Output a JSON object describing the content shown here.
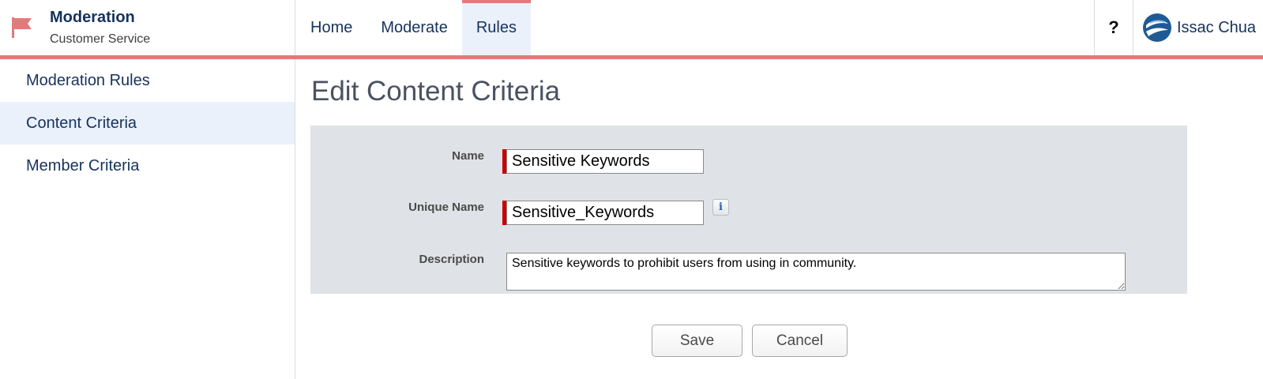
{
  "app": {
    "title": "Moderation",
    "subtitle": "Customer Service"
  },
  "nav": {
    "items": [
      {
        "label": "Home",
        "active": false
      },
      {
        "label": "Moderate",
        "active": false
      },
      {
        "label": "Rules",
        "active": true
      }
    ],
    "help_label": "?"
  },
  "user": {
    "name": "Issac Chua"
  },
  "sidebar": {
    "items": [
      {
        "label": "Moderation Rules",
        "active": false
      },
      {
        "label": "Content Criteria",
        "active": true
      },
      {
        "label": "Member Criteria",
        "active": false
      }
    ]
  },
  "page": {
    "title": "Edit Content Criteria"
  },
  "form": {
    "name_label": "Name",
    "name_value": "Sensitive Keywords",
    "unique_name_label": "Unique Name",
    "unique_name_value": "Sensitive_Keywords",
    "info_glyph": "i",
    "description_label": "Description",
    "description_value": "Sensitive keywords to prohibit users from using in community."
  },
  "buttons": {
    "save_label": "Save",
    "cancel_label": "Cancel"
  },
  "colors": {
    "accent": "#e07b7b",
    "active_bg": "#eaf1fb",
    "required": "#cc0000",
    "panel_bg": "#dfe2e6"
  }
}
